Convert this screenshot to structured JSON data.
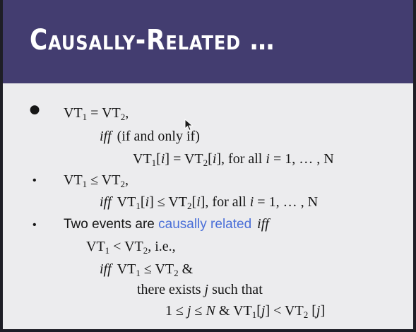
{
  "slide": {
    "title": "Causally-Related …",
    "colors": {
      "banner": "#433d70",
      "title_text": "#ffffff",
      "body_text": "#161616",
      "accent": "#4a6fd8",
      "background": "#ececee"
    }
  },
  "content": {
    "p1": {
      "bullet": "●",
      "l1": {
        "vt": "VT",
        "s1": "1",
        "op": " = VT",
        "s2": "2",
        "tail": ","
      },
      "l2": {
        "iff": "iff",
        "rest": "(if and only if)"
      },
      "l3": {
        "vt": "VT",
        "s1": "1",
        "b1": "[",
        "i1": "i",
        "m": "] = VT",
        "s2": "2",
        "b2": "[",
        "i2": "i",
        "m2": "], for all ",
        "i3": "i",
        "tail": " = 1, … , N"
      }
    },
    "p2": {
      "bullet": "•",
      "l1": {
        "vt": "VT",
        "s1": "1",
        "op": " ≤ VT",
        "s2": "2",
        "tail": ","
      },
      "l2": {
        "iff": "iff",
        "vt": "VT",
        "s1": "1",
        "b1": "[",
        "i1": "i",
        "m": "] ≤ VT",
        "s2": "2",
        "b2": "[",
        "i2": "i",
        "m2": "], for all ",
        "i3": "i",
        "tail": " = 1, … , N"
      }
    },
    "p3": {
      "bullet": "•",
      "l1": {
        "pre": "Two events are ",
        "accent": "causally related",
        "iff": "iff"
      },
      "l2": {
        "vt": "VT",
        "s1": "1",
        "op": " < VT",
        "s2": "2",
        "tail": ",  i.e.,"
      },
      "l3": {
        "iff": "iff",
        "vt": "VT",
        "s1": "1",
        "op": " ≤ VT",
        "s2": "2",
        "tail": " &"
      },
      "l4": {
        "pre": "there exists ",
        "j": "j",
        "tail": " such that"
      },
      "l5": {
        "pre": "1 ≤ ",
        "j1": "j",
        "m": " ≤ ",
        "n": "N",
        "m2": " & VT",
        "s1": "1",
        "b1": "[",
        "j2": "j",
        "m3": "] < VT",
        "s2": "2",
        "b2": " [",
        "j3": "j",
        "tail": "]"
      }
    }
  },
  "pointer": {
    "icon": "mouse-pointer-icon"
  }
}
